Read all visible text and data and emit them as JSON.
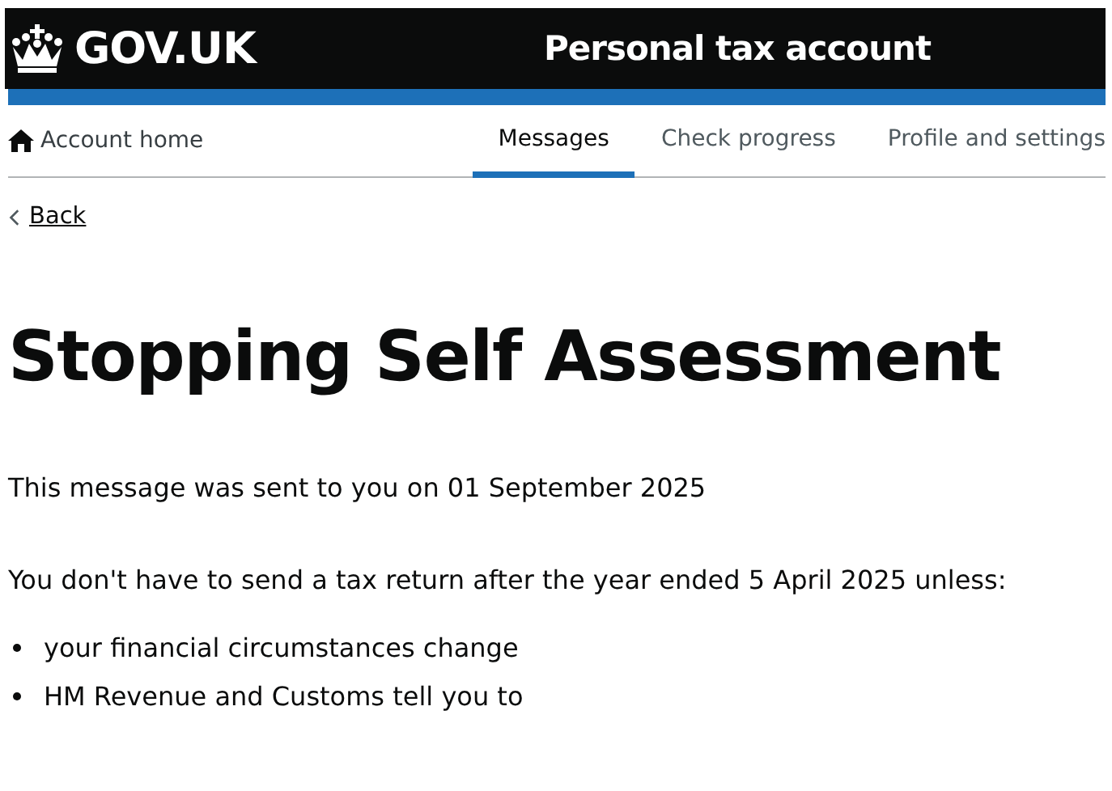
{
  "header": {
    "logo": "GOV.UK",
    "service": "Personal tax account"
  },
  "nav": {
    "home": "Account home",
    "items": [
      {
        "label": "Messages",
        "selected": true
      },
      {
        "label": "Check progress",
        "selected": false
      },
      {
        "label": "Profile and settings",
        "selected": false
      }
    ]
  },
  "back_link": "Back",
  "heading": "Stopping Self Assessment",
  "paragraphs": [
    "This message was sent to you on 01 September 2025",
    "You don't have to send a tax return after the year ended 5 April 2025 unless:"
  ],
  "bullets": [
    "your financial circumstances change",
    "HM Revenue and Customs tell you to"
  ]
}
